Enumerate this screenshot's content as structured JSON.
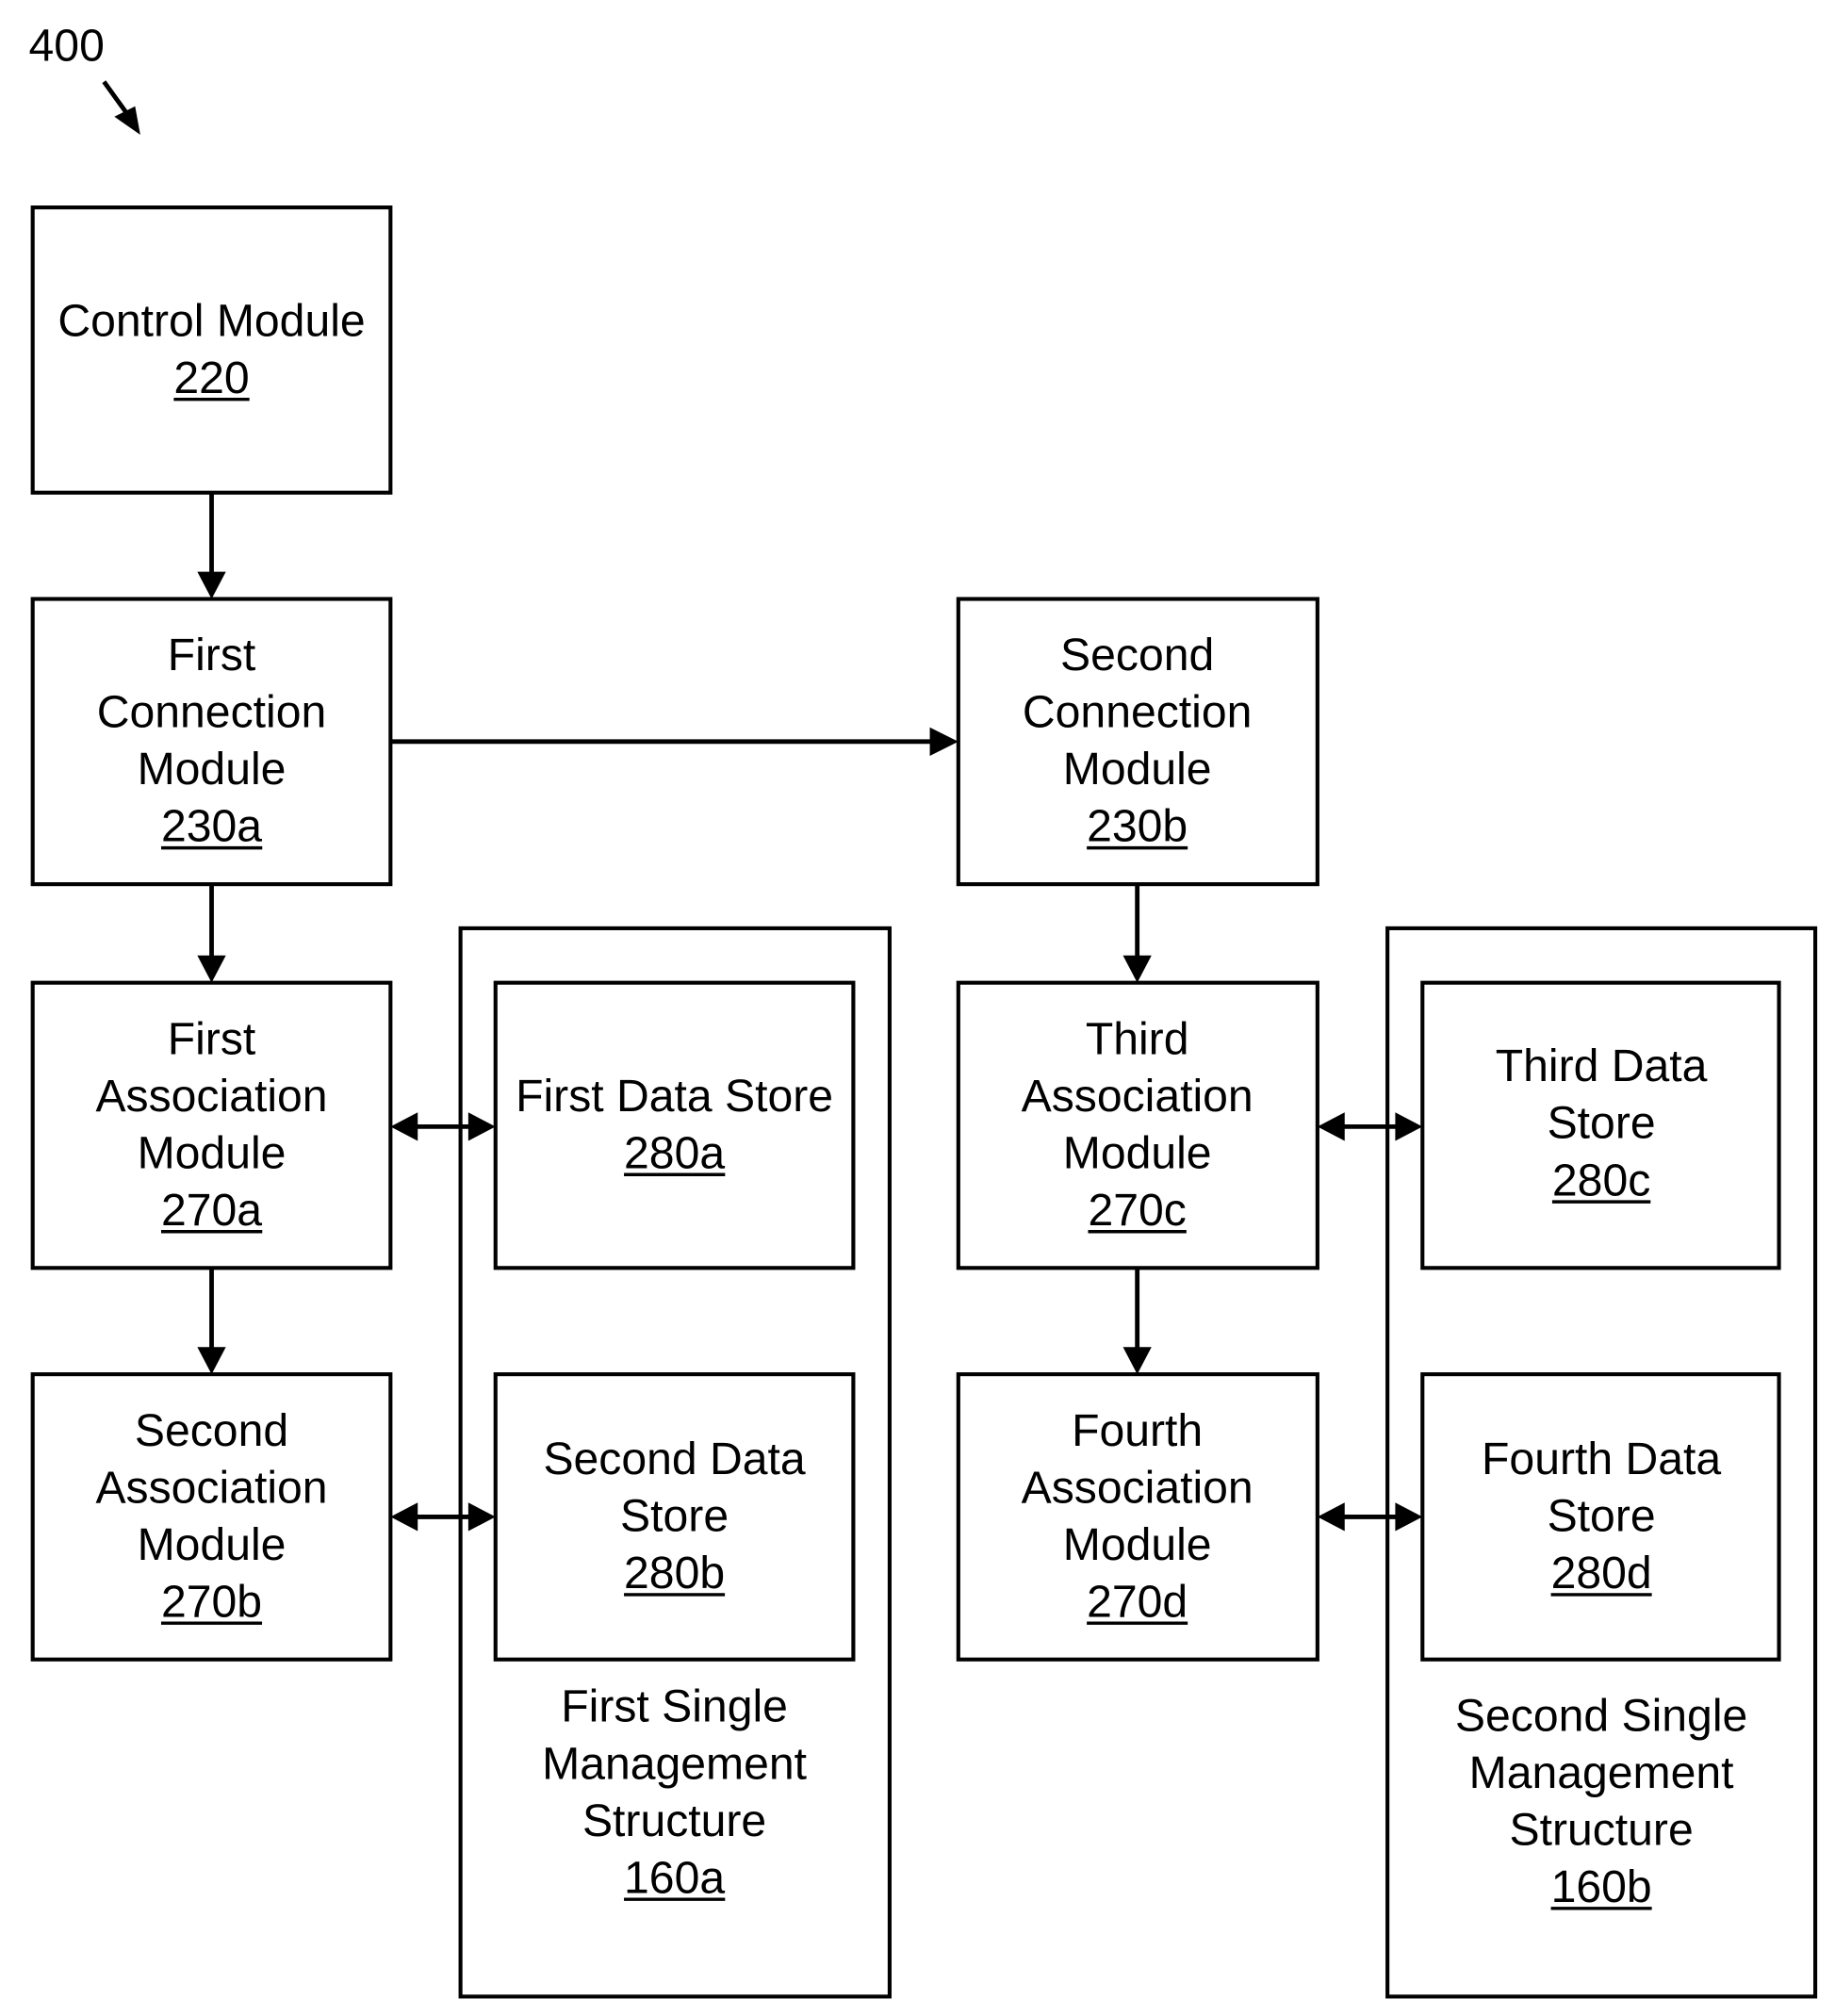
{
  "figure": {
    "number": "400",
    "stroke_color": "#000000",
    "background": "#ffffff"
  },
  "nodes": {
    "control_module": {
      "lines": [
        "Control Module"
      ],
      "ref": "220"
    },
    "first_connection_module": {
      "lines": [
        "First",
        "Connection",
        "Module"
      ],
      "ref": "230a"
    },
    "second_connection_module": {
      "lines": [
        "Second",
        "Connection",
        "Module"
      ],
      "ref": "230b"
    },
    "first_association_module": {
      "lines": [
        "First",
        "Association",
        "Module"
      ],
      "ref": "270a"
    },
    "second_association_module": {
      "lines": [
        "Second",
        "Association",
        "Module"
      ],
      "ref": "270b"
    },
    "third_association_module": {
      "lines": [
        "Third",
        "Association",
        "Module"
      ],
      "ref": "270c"
    },
    "fourth_association_module": {
      "lines": [
        "Fourth",
        "Association",
        "Module"
      ],
      "ref": "270d"
    },
    "first_data_store": {
      "lines": [
        "First Data Store"
      ],
      "ref": "280a"
    },
    "second_data_store": {
      "lines": [
        "Second Data",
        "Store"
      ],
      "ref": "280b"
    },
    "third_data_store": {
      "lines": [
        "Third Data",
        "Store"
      ],
      "ref": "280c"
    },
    "fourth_data_store": {
      "lines": [
        "Fourth Data",
        "Store"
      ],
      "ref": "280d"
    },
    "first_single_management_structure": {
      "lines": [
        "First Single",
        "Management",
        "Structure"
      ],
      "ref": "160a"
    },
    "second_single_management_structure": {
      "lines": [
        "Second Single",
        "Management",
        "Structure"
      ],
      "ref": "160b"
    }
  },
  "edges": [
    {
      "from": "control_module",
      "to": "first_connection_module",
      "direction": "one-way"
    },
    {
      "from": "first_connection_module",
      "to": "second_connection_module",
      "direction": "one-way"
    },
    {
      "from": "first_connection_module",
      "to": "first_association_module",
      "direction": "one-way"
    },
    {
      "from": "first_association_module",
      "to": "second_association_module",
      "direction": "one-way"
    },
    {
      "from": "second_connection_module",
      "to": "third_association_module",
      "direction": "one-way"
    },
    {
      "from": "third_association_module",
      "to": "fourth_association_module",
      "direction": "one-way"
    },
    {
      "from": "first_association_module",
      "to": "first_data_store",
      "direction": "two-way"
    },
    {
      "from": "second_association_module",
      "to": "second_data_store",
      "direction": "two-way"
    },
    {
      "from": "third_association_module",
      "to": "third_data_store",
      "direction": "two-way"
    },
    {
      "from": "fourth_association_module",
      "to": "fourth_data_store",
      "direction": "two-way"
    }
  ]
}
